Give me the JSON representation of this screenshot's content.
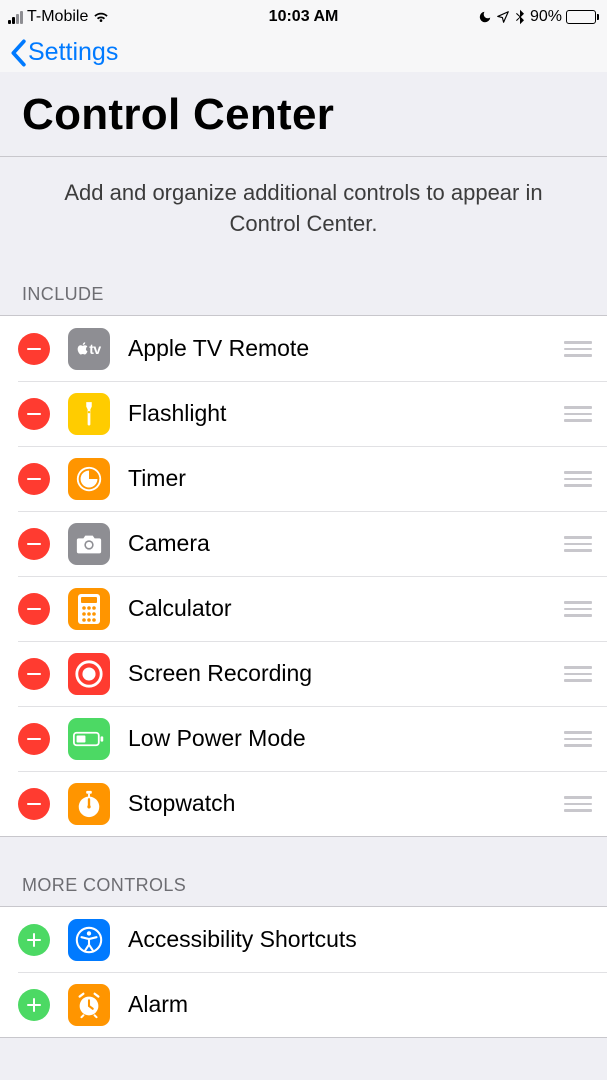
{
  "status": {
    "carrier": "T-Mobile",
    "time": "10:03 AM",
    "battery_pct": "90%"
  },
  "nav": {
    "back_label": "Settings",
    "title": "Control Center"
  },
  "description": "Add and organize additional controls to appear in Control Center.",
  "sections": {
    "include_header": "INCLUDE",
    "more_header": "MORE CONTROLS"
  },
  "include": [
    {
      "label": "Apple TV Remote",
      "icon": "appletv"
    },
    {
      "label": "Flashlight",
      "icon": "flashlight"
    },
    {
      "label": "Timer",
      "icon": "timer"
    },
    {
      "label": "Camera",
      "icon": "camera"
    },
    {
      "label": "Calculator",
      "icon": "calc"
    },
    {
      "label": "Screen Recording",
      "icon": "record"
    },
    {
      "label": "Low Power Mode",
      "icon": "lowpower"
    },
    {
      "label": "Stopwatch",
      "icon": "stopwatch"
    }
  ],
  "more": [
    {
      "label": "Accessibility Shortcuts",
      "icon": "a11y"
    },
    {
      "label": "Alarm",
      "icon": "alarm"
    }
  ]
}
